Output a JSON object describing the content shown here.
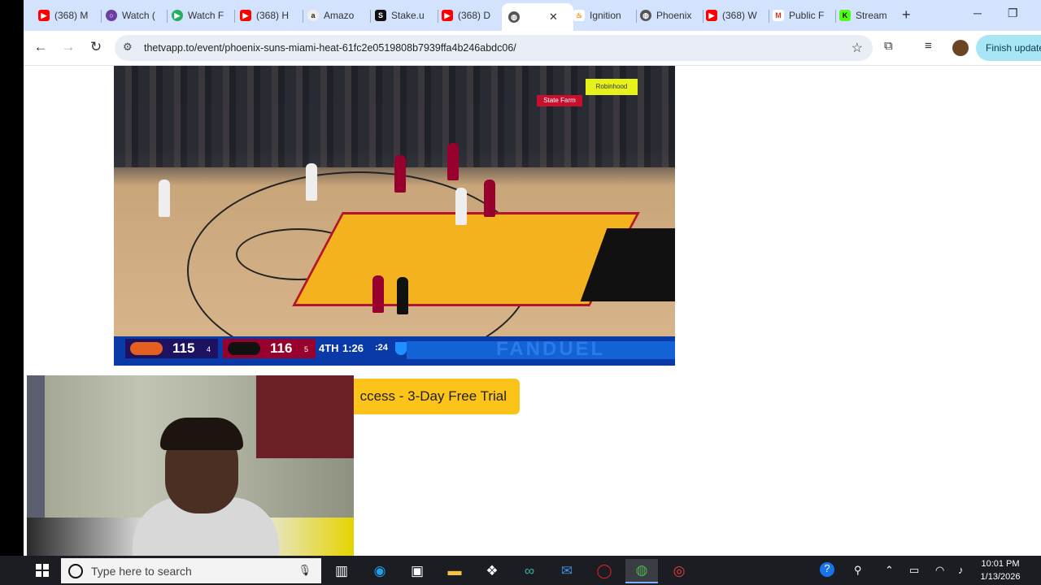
{
  "browser": {
    "tabs": [
      {
        "label": "(368) M",
        "icon": "youtube-icon",
        "color": "#ff0000"
      },
      {
        "label": "Watch (",
        "icon": "purple-ring-icon",
        "color": "#6b3fa0"
      },
      {
        "label": "Watch F",
        "icon": "green-play-icon",
        "color": "#27ae60"
      },
      {
        "label": "(368) H",
        "icon": "youtube-icon",
        "color": "#ff0000"
      },
      {
        "label": "Amazo",
        "icon": "amazon-icon",
        "color": "#222222"
      },
      {
        "label": "Stake.u",
        "icon": "stake-icon",
        "color": "#111111"
      },
      {
        "label": "(368) D",
        "icon": "youtube-icon",
        "color": "#ff0000"
      },
      {
        "label": "",
        "icon": "globe-icon",
        "color": "#555555"
      },
      {
        "label": "Ignition",
        "icon": "flame-icon",
        "color": "#f08c00"
      },
      {
        "label": "Phoenix",
        "icon": "globe-icon",
        "color": "#555555"
      },
      {
        "label": "(368) W",
        "icon": "youtube-icon",
        "color": "#ff0000"
      },
      {
        "label": "Public F",
        "icon": "gmail-icon",
        "color": "#d93025"
      },
      {
        "label": "Stream",
        "icon": "kick-icon",
        "color": "#53fc18"
      }
    ],
    "url": "thetvapp.to/event/phoenix-suns-miami-heat-61fc2e0519808b7939ffa4b246abdc06/",
    "update_label": "Finish update"
  },
  "video": {
    "promo_tag": "Robinhood",
    "sponsor": "State Farm",
    "scorebug": {
      "team1_score": "115",
      "team1_timeouts": "4",
      "team2_score": "116",
      "team2_timeouts": "5",
      "quarter": "4TH",
      "clock": "1:26",
      "shot_clock": ":24",
      "brand": "FANDUEL"
    }
  },
  "page": {
    "cta_label": "ccess - 3-Day Free Trial"
  },
  "taskbar": {
    "search_placeholder": "Type here to search",
    "time": "10:01 PM",
    "date": "1/13/2026"
  }
}
